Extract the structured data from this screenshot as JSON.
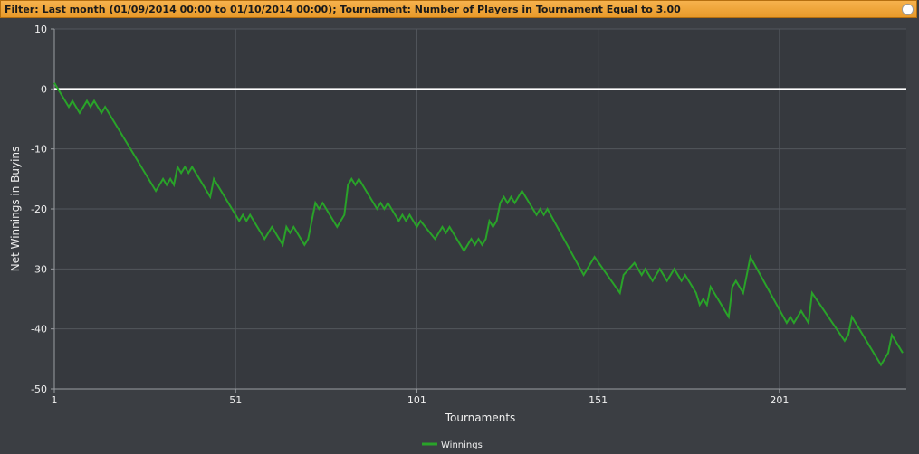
{
  "filter": {
    "label": "Filter:",
    "text": "Last month (01/09/2014 00:00 to 01/10/2014 00:00); Tournament: Number of Players in Tournament Equal to 3.00"
  },
  "colors": {
    "accent": "#f0a43a",
    "series": "#29a329",
    "zero_line": "#ffffff",
    "plot_bg": "#36393e"
  },
  "chart_data": {
    "type": "line",
    "xlabel": "Tournaments",
    "ylabel": "Net Winnings in Buyins",
    "xlim": [
      1,
      236
    ],
    "ylim": [
      -50,
      10
    ],
    "xticks": [
      1,
      51,
      101,
      151,
      201
    ],
    "yticks": [
      10,
      0,
      -10,
      -20,
      -30,
      -40,
      -50
    ],
    "grid": true,
    "legend_position": "bottom-center",
    "series": [
      {
        "name": "Winnings",
        "color": "#29a329",
        "points": [
          [
            1,
            1
          ],
          [
            2,
            0
          ],
          [
            4,
            -2
          ],
          [
            5,
            -3
          ],
          [
            6,
            -2
          ],
          [
            8,
            -4
          ],
          [
            9,
            -3
          ],
          [
            10,
            -2
          ],
          [
            11,
            -3
          ],
          [
            12,
            -2
          ],
          [
            14,
            -4
          ],
          [
            15,
            -3
          ],
          [
            16,
            -4
          ],
          [
            29,
            -17
          ],
          [
            31,
            -15
          ],
          [
            32,
            -16
          ],
          [
            33,
            -15
          ],
          [
            34,
            -16
          ],
          [
            35,
            -13
          ],
          [
            36,
            -14
          ],
          [
            37,
            -13
          ],
          [
            38,
            -14
          ],
          [
            39,
            -13
          ],
          [
            44,
            -18
          ],
          [
            45,
            -15
          ],
          [
            52,
            -22
          ],
          [
            53,
            -21
          ],
          [
            54,
            -22
          ],
          [
            55,
            -21
          ],
          [
            59,
            -25
          ],
          [
            60,
            -24
          ],
          [
            61,
            -23
          ],
          [
            64,
            -26
          ],
          [
            65,
            -23
          ],
          [
            66,
            -24
          ],
          [
            67,
            -23
          ],
          [
            70,
            -26
          ],
          [
            71,
            -25
          ],
          [
            73,
            -19
          ],
          [
            74,
            -20
          ],
          [
            75,
            -19
          ],
          [
            79,
            -23
          ],
          [
            81,
            -21
          ],
          [
            82,
            -16
          ],
          [
            83,
            -15
          ],
          [
            84,
            -16
          ],
          [
            85,
            -15
          ],
          [
            90,
            -20
          ],
          [
            91,
            -19
          ],
          [
            92,
            -20
          ],
          [
            93,
            -19
          ],
          [
            96,
            -22
          ],
          [
            97,
            -21
          ],
          [
            98,
            -22
          ],
          [
            99,
            -21
          ],
          [
            101,
            -23
          ],
          [
            102,
            -22
          ],
          [
            106,
            -25
          ],
          [
            107,
            -24
          ],
          [
            108,
            -23
          ],
          [
            109,
            -24
          ],
          [
            110,
            -23
          ],
          [
            113,
            -26
          ],
          [
            114,
            -27
          ],
          [
            116,
            -25
          ],
          [
            117,
            -26
          ],
          [
            118,
            -25
          ],
          [
            119,
            -26
          ],
          [
            120,
            -25
          ],
          [
            121,
            -22
          ],
          [
            122,
            -23
          ],
          [
            123,
            -22
          ],
          [
            124,
            -19
          ],
          [
            125,
            -18
          ],
          [
            126,
            -19
          ],
          [
            127,
            -18
          ],
          [
            128,
            -19
          ],
          [
            130,
            -17
          ],
          [
            134,
            -21
          ],
          [
            135,
            -20
          ],
          [
            136,
            -21
          ],
          [
            137,
            -20
          ],
          [
            147,
            -31
          ],
          [
            150,
            -28
          ],
          [
            157,
            -34
          ],
          [
            158,
            -31
          ],
          [
            161,
            -29
          ],
          [
            163,
            -31
          ],
          [
            164,
            -30
          ],
          [
            166,
            -32
          ],
          [
            168,
            -30
          ],
          [
            170,
            -32
          ],
          [
            172,
            -30
          ],
          [
            174,
            -32
          ],
          [
            175,
            -31
          ],
          [
            178,
            -34
          ],
          [
            179,
            -36
          ],
          [
            180,
            -35
          ],
          [
            181,
            -36
          ],
          [
            182,
            -33
          ],
          [
            187,
            -38
          ],
          [
            188,
            -33
          ],
          [
            189,
            -32
          ],
          [
            191,
            -34
          ],
          [
            193,
            -28
          ],
          [
            203,
            -39
          ],
          [
            204,
            -38
          ],
          [
            205,
            -39
          ],
          [
            207,
            -37
          ],
          [
            209,
            -39
          ],
          [
            210,
            -34
          ],
          [
            219,
            -42
          ],
          [
            220,
            -41
          ],
          [
            221,
            -38
          ],
          [
            229,
            -46
          ],
          [
            231,
            -44
          ],
          [
            232,
            -41
          ],
          [
            235,
            -44
          ]
        ]
      }
    ]
  }
}
